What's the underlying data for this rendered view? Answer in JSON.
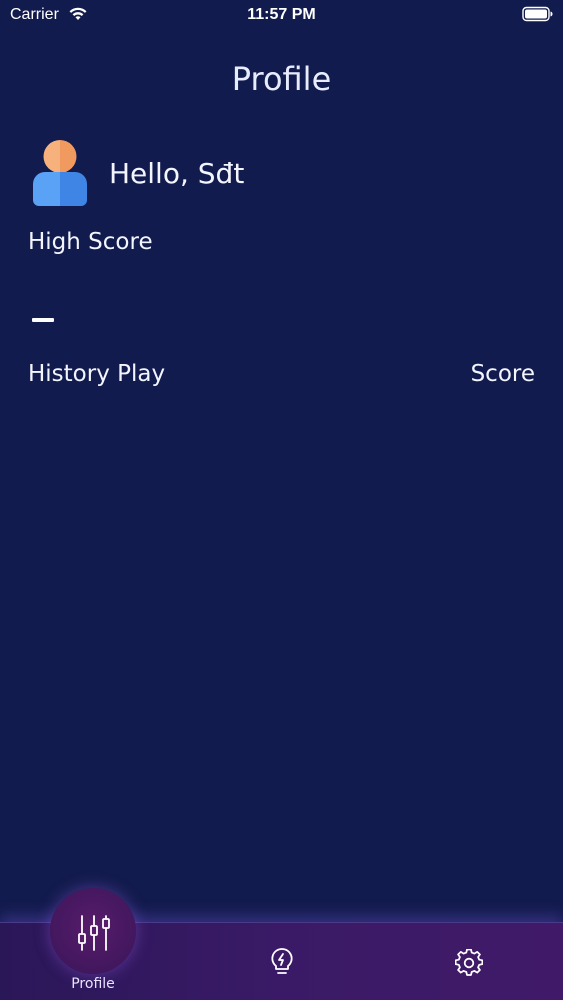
{
  "status_bar": {
    "carrier": "Carrier",
    "time": "11:57 PM"
  },
  "header": {
    "title": "Profile"
  },
  "profile": {
    "greeting": "Hello, Sđt",
    "high_score_label": "High Score",
    "high_score_value": "–"
  },
  "history": {
    "label": "History Play",
    "score_label": "Score"
  },
  "tab_bar": {
    "profile_label": "Profile",
    "active_tab": "Profile"
  },
  "colors": {
    "background": "#121b4d",
    "tab_bar": "#3a1a66",
    "active_bubble": "#571c6a",
    "avatar_head": "#f5a86e",
    "avatar_body": "#4d90f0"
  }
}
